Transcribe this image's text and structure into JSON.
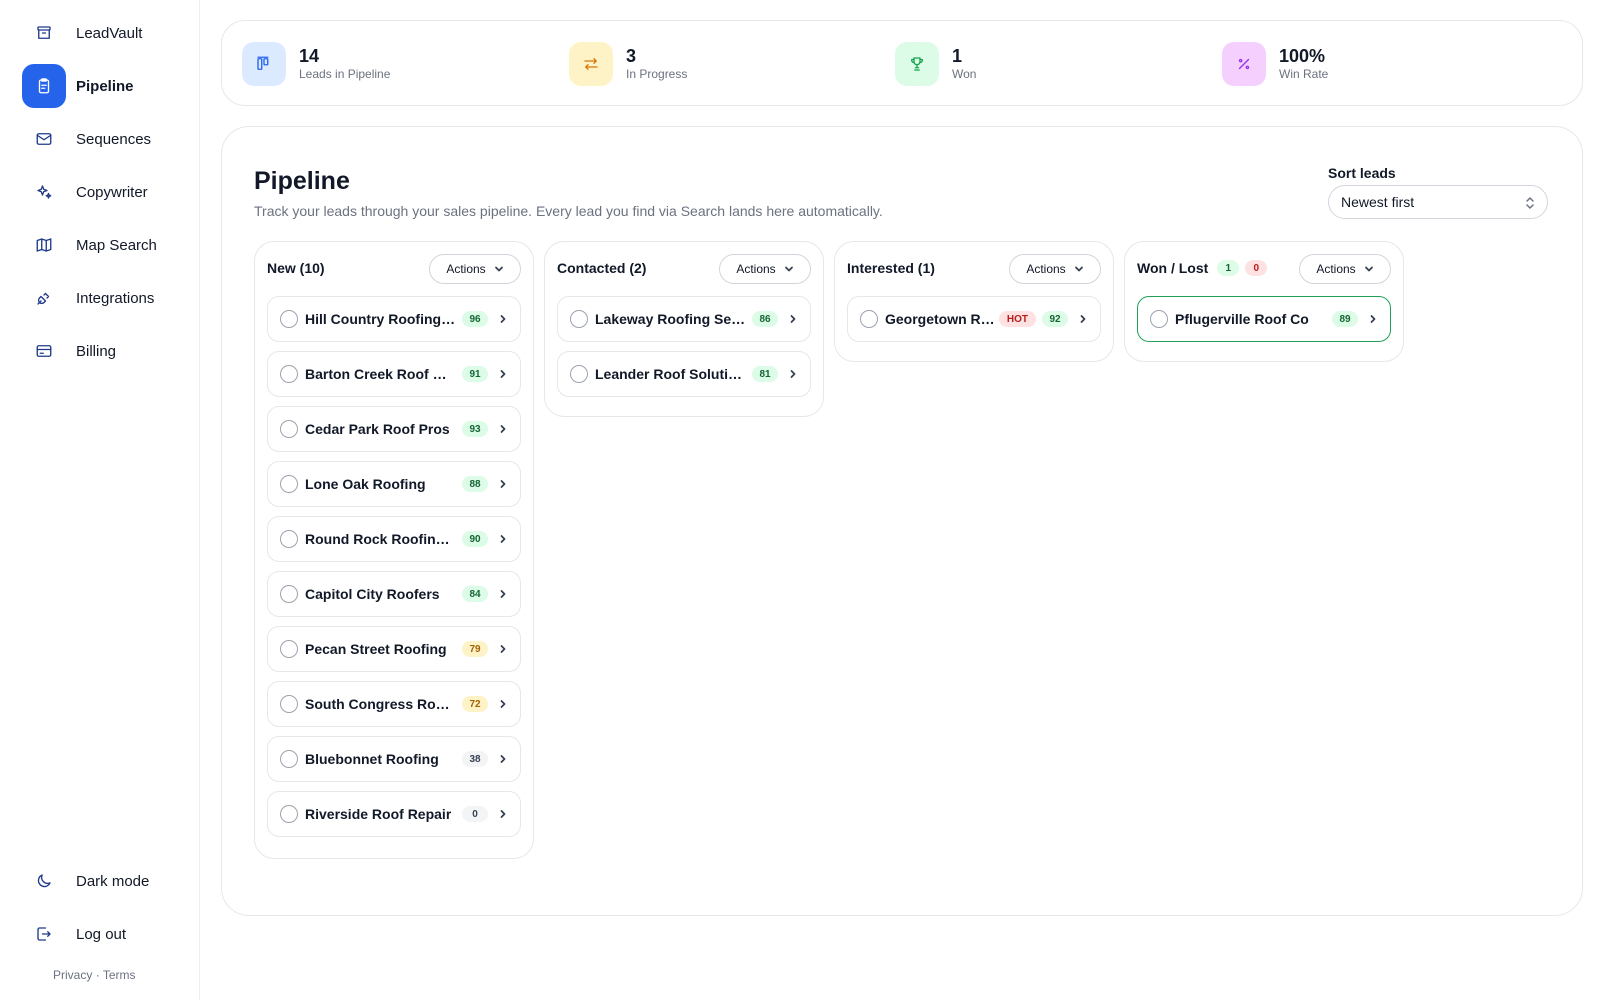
{
  "colors": {
    "accent": "#2563eb",
    "score_green": "#dcfce7",
    "score_yellow": "#fef3c7",
    "hot": "#fee2e2",
    "won_border": "#22a05a"
  },
  "sidebar": {
    "items": [
      {
        "label": "LeadVault",
        "icon": "archive-icon",
        "active": false
      },
      {
        "label": "Pipeline",
        "icon": "clipboard-icon",
        "active": true
      },
      {
        "label": "Sequences",
        "icon": "mail-icon",
        "active": false
      },
      {
        "label": "Copywriter",
        "icon": "sparkles-icon",
        "active": false
      },
      {
        "label": "Map Search",
        "icon": "map-icon",
        "active": false
      },
      {
        "label": "Integrations",
        "icon": "plug-icon",
        "active": false
      },
      {
        "label": "Billing",
        "icon": "credit-card-icon",
        "active": false
      }
    ],
    "bottom": [
      {
        "label": "Dark mode",
        "icon": "moon-icon"
      },
      {
        "label": "Log out",
        "icon": "logout-icon"
      }
    ],
    "legal": {
      "privacy": "Privacy",
      "separator": "·",
      "terms": "Terms"
    }
  },
  "stats": [
    {
      "value": "14",
      "label": "Leads in Pipeline",
      "icon": "kanban-icon",
      "bg": "#dbeafe",
      "color": "#2563eb"
    },
    {
      "value": "3",
      "label": "In Progress",
      "icon": "arrows-swap-icon",
      "bg": "#fef3c7",
      "color": "#d97706"
    },
    {
      "value": "1",
      "label": "Won",
      "icon": "trophy-icon",
      "bg": "#dcfce7",
      "color": "#16a34a"
    },
    {
      "value": "100%",
      "label": "Win Rate",
      "icon": "percent-icon",
      "bg": "#f5d0fe",
      "color": "#9333ea"
    }
  ],
  "pipeline": {
    "title": "Pipeline",
    "subtitle": "Track your leads through your sales pipeline. Every lead you find via Search lands here automatically.",
    "sort_label": "Sort leads",
    "sort_value": "Newest first",
    "actions_label": "Actions",
    "columns": [
      {
        "title": "New (10)",
        "leads": [
          {
            "name": "Hill Country Roofing Co",
            "score": "96",
            "tone": "green"
          },
          {
            "name": "Barton Creek Roof Repair",
            "score": "91",
            "tone": "green"
          },
          {
            "name": "Cedar Park Roof Pros",
            "score": "93",
            "tone": "green"
          },
          {
            "name": "Lone Oak Roofing",
            "score": "88",
            "tone": "green"
          },
          {
            "name": "Round Rock Roofing LLC",
            "score": "90",
            "tone": "green"
          },
          {
            "name": "Capitol City Roofers",
            "score": "84",
            "tone": "green"
          },
          {
            "name": "Pecan Street Roofing",
            "score": "79",
            "tone": "yellow"
          },
          {
            "name": "South Congress Roofing",
            "score": "72",
            "tone": "yellow"
          },
          {
            "name": "Bluebonnet Roofing",
            "score": "38",
            "tone": "gray"
          },
          {
            "name": "Riverside Roof Repair",
            "score": "0",
            "tone": "gray"
          }
        ]
      },
      {
        "title": "Contacted (2)",
        "leads": [
          {
            "name": "Lakeway Roofing Services",
            "score": "86",
            "tone": "green"
          },
          {
            "name": "Leander Roof Solutions",
            "score": "81",
            "tone": "green"
          }
        ]
      },
      {
        "title": "Interested (1)",
        "leads": [
          {
            "name": "Georgetown Roofing",
            "hot": "HOT",
            "score": "92",
            "tone": "green"
          }
        ]
      },
      {
        "title": "Won / Lost",
        "won_count": "1",
        "lost_count": "0",
        "leads": [
          {
            "name": "Pflugerville Roof Co",
            "score": "89",
            "tone": "green",
            "highlight": true
          }
        ]
      }
    ]
  }
}
